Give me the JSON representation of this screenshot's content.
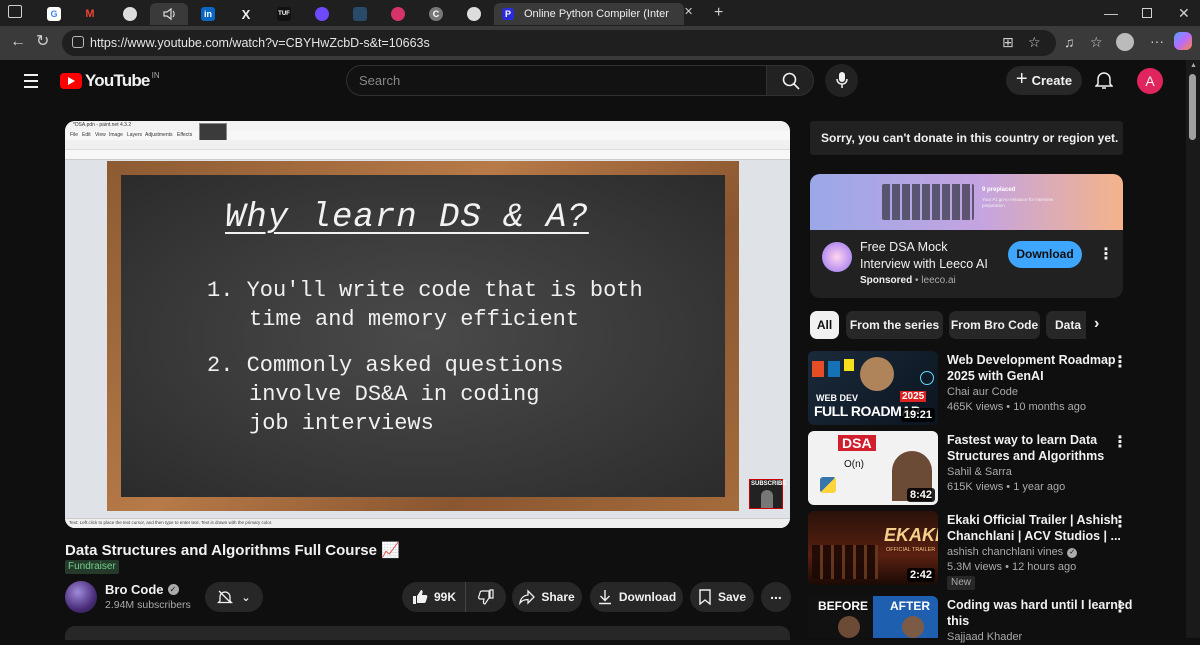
{
  "browser": {
    "active_tab_title": "Online Python Compiler (Interpre",
    "url": "https://www.youtube.com/watch?v=CBYHwZcbD-s&t=10663s",
    "tab_favicons": [
      "G",
      "M",
      "in",
      "X",
      "P",
      "C"
    ]
  },
  "youtube": {
    "logo_text": "YouTube",
    "country_code": "IN",
    "search_placeholder": "Search",
    "create_label": "Create",
    "avatar_letter": "A"
  },
  "video": {
    "paint_title": "*DSA.pdn - paint.net 4.3.2",
    "paint_menu": [
      "File",
      "Edit",
      "View",
      "Image",
      "Layers",
      "Adjustments",
      "Effects"
    ],
    "board_heading": "Why learn DS & A?",
    "point1_line1": "1. You'll write code that is both",
    "point1_line2": "time and memory efficient",
    "point2_line1": "2. Commonly asked questions",
    "point2_line2": "involve DS&A in coding",
    "point2_line3": "job interviews",
    "subscribe_overlay": "SUBSCRIBE",
    "status_bar": "Text: Left click to place the text cursor, and then type to enter text. Text is drawn with the primary color.",
    "title": "Data Structures and Algorithms Full Course 📈",
    "fundraiser_label": "Fundraiser",
    "channel_name": "Bro Code",
    "subscribers": "2.94M subscribers",
    "likes": "99K",
    "share_label": "Share",
    "download_label": "Download",
    "save_label": "Save"
  },
  "sidebar": {
    "donate_notice": "Sorry, you can't donate in this country or region yet.",
    "ad": {
      "banner_heading": "9 preplaced",
      "banner_sub": "Your #1 go-to resource for interview preparation",
      "title_line1": "Free DSA Mock",
      "title_line2": "Interview with Leeco AI",
      "sponsored": "Sponsored",
      "domain": "leeco.ai",
      "button": "Download"
    },
    "chips": [
      "All",
      "From the series",
      "From Bro Code",
      "Data"
    ],
    "recommendations": [
      {
        "title_line1": "Web Development Roadmap",
        "title_line2": "2025 with GenAI",
        "channel": "Chai aur Code",
        "meta": "465K views • 10 months ago",
        "duration": "19:21",
        "thumb_text1": "WEB DEV",
        "thumb_text2": "FULL ROADMAP",
        "thumb_text3": "2025"
      },
      {
        "title_line1": "Fastest way to learn Data",
        "title_line2": "Structures and Algorithms",
        "channel": "Sahil & Sarra",
        "meta": "615K views • 1 year ago",
        "duration": "8:42",
        "thumb_text1": "DSA",
        "thumb_text2": "O(n)"
      },
      {
        "title_line1": "Ekaki Official Trailer | Ashish",
        "title_line2": "Chanchlani | ACV Studios | ...",
        "channel": "ashish chanchlani vines",
        "meta": "5.3M views • 12 hours ago",
        "duration": "2:42",
        "badge": "New",
        "thumb_text1": "EKAKI",
        "thumb_text2": "OFFICIAL TRAILER"
      },
      {
        "title_line1": "Coding was hard until I learned",
        "title_line2": "this",
        "channel": "Sajjaad Khader",
        "thumb_text1": "BEFORE",
        "thumb_text2": "AFTER"
      }
    ]
  },
  "colors": {
    "youtube_red": "#ff0000",
    "download_blue": "#3ea6ff",
    "avatar_pink": "#e0245e",
    "chalkboard": "#3b3b3b",
    "frame_wood": "#a0663a"
  }
}
